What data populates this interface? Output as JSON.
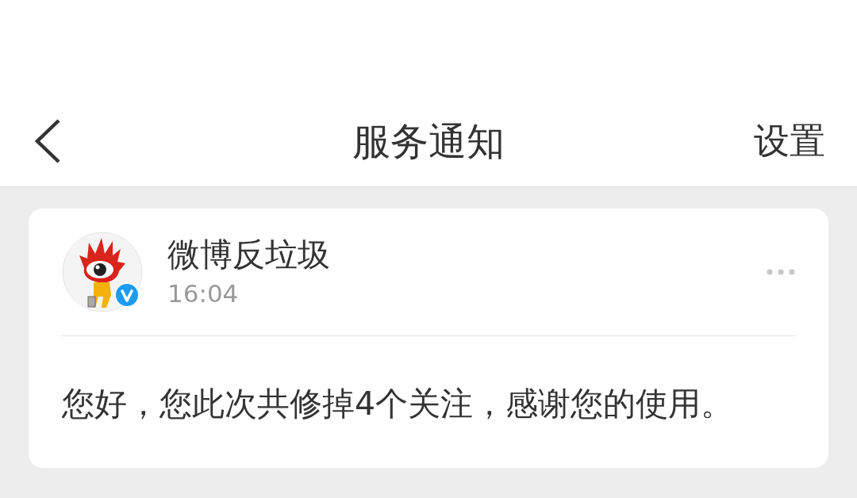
{
  "header": {
    "title": "服务通知",
    "action": "设置"
  },
  "notifications": [
    {
      "sender": "微博反垃圾",
      "time": "16:04",
      "verified": true,
      "message": "您好，您此次共修掉4个关注，感谢您的使用。"
    }
  ]
}
